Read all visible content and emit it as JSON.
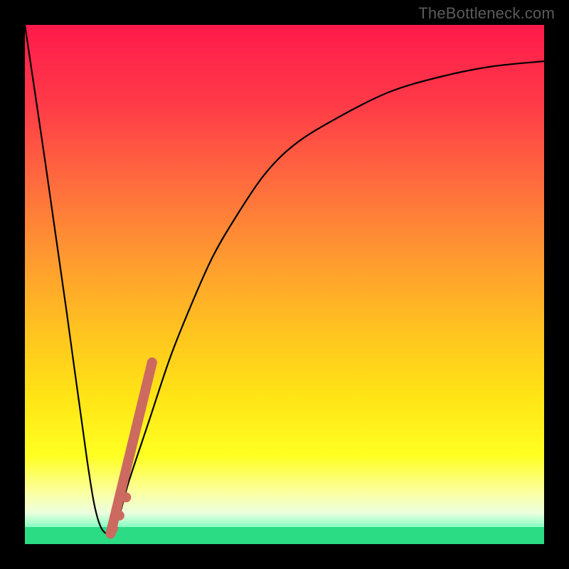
{
  "watermark": "TheBottleneck.com",
  "colors": {
    "frame": "#000000",
    "curve": "#000000",
    "greenBand": "#2bdc84",
    "markers": "#cc6a5f",
    "gradientStops": [
      {
        "offset": 0.0,
        "color": "#ff1a4b"
      },
      {
        "offset": 0.15,
        "color": "#ff3a48"
      },
      {
        "offset": 0.3,
        "color": "#ff6a3e"
      },
      {
        "offset": 0.45,
        "color": "#ff9a30"
      },
      {
        "offset": 0.6,
        "color": "#ffc61e"
      },
      {
        "offset": 0.72,
        "color": "#ffe516"
      },
      {
        "offset": 0.83,
        "color": "#ffff22"
      },
      {
        "offset": 0.9,
        "color": "#fbffa0"
      },
      {
        "offset": 0.94,
        "color": "#ecffdf"
      },
      {
        "offset": 0.965,
        "color": "#8fffc5"
      },
      {
        "offset": 1.0,
        "color": "#2bdc84"
      }
    ]
  },
  "chart_data": {
    "type": "line",
    "title": "",
    "xlabel": "",
    "ylabel": "",
    "xlim": [
      0,
      1
    ],
    "ylim": [
      0,
      1
    ],
    "series": [
      {
        "name": "bottleneck-curve",
        "x": [
          0.0,
          0.04,
          0.08,
          0.12,
          0.14,
          0.16,
          0.18,
          0.2,
          0.24,
          0.28,
          0.32,
          0.36,
          0.4,
          0.46,
          0.52,
          0.6,
          0.7,
          0.8,
          0.9,
          1.0
        ],
        "values": [
          1.0,
          0.73,
          0.45,
          0.16,
          0.05,
          0.02,
          0.05,
          0.12,
          0.24,
          0.36,
          0.46,
          0.55,
          0.62,
          0.71,
          0.77,
          0.82,
          0.87,
          0.9,
          0.92,
          0.93
        ]
      },
      {
        "name": "marker-stroke",
        "x": [
          0.165,
          0.245
        ],
        "values": [
          0.02,
          0.35
        ]
      }
    ],
    "scatter": {
      "name": "marker-dots",
      "x": [
        0.17,
        0.182,
        0.195
      ],
      "values": [
        0.03,
        0.055,
        0.09
      ]
    }
  }
}
